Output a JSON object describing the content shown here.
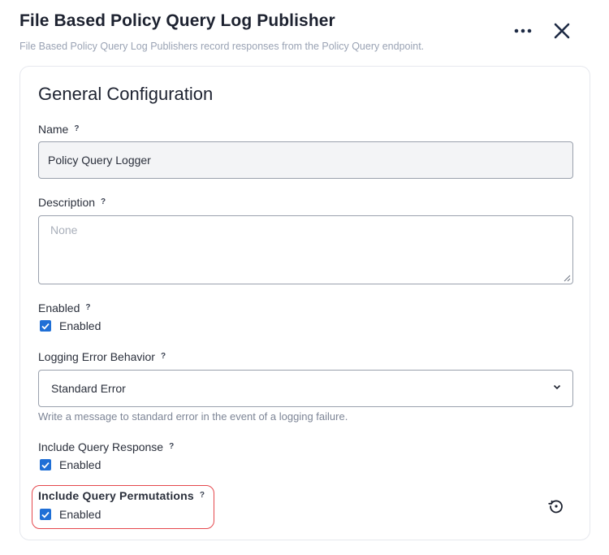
{
  "header": {
    "title": "File Based Policy Query Log Publisher",
    "subtitle": "File Based Policy Query Log Publishers record responses from the Policy Query endpoint."
  },
  "icons": {
    "more": "more-horizontal-icon",
    "close": "close-icon",
    "help": "help-icon",
    "check": "check-icon",
    "chevron": "chevron-down-icon",
    "reset": "reset-history-icon"
  },
  "colors": {
    "accent": "#1f6fd6",
    "highlight": "#e5484d"
  },
  "section": {
    "title": "General Configuration",
    "help_glyph": "?"
  },
  "fields": {
    "name": {
      "label": "Name",
      "value": "Policy Query Logger"
    },
    "description": {
      "label": "Description",
      "placeholder": "None"
    },
    "enabled": {
      "label": "Enabled",
      "checkbox_label": "Enabled",
      "checked": true
    },
    "logging_error_behavior": {
      "label": "Logging Error Behavior",
      "value": "Standard Error",
      "hint": "Write a message to standard error in the event of a logging failure."
    },
    "include_query_response": {
      "label": "Include Query Response",
      "checkbox_label": "Enabled",
      "checked": true
    },
    "include_query_permutations": {
      "label": "Include Query Permutations",
      "checkbox_label": "Enabled",
      "checked": true
    }
  }
}
